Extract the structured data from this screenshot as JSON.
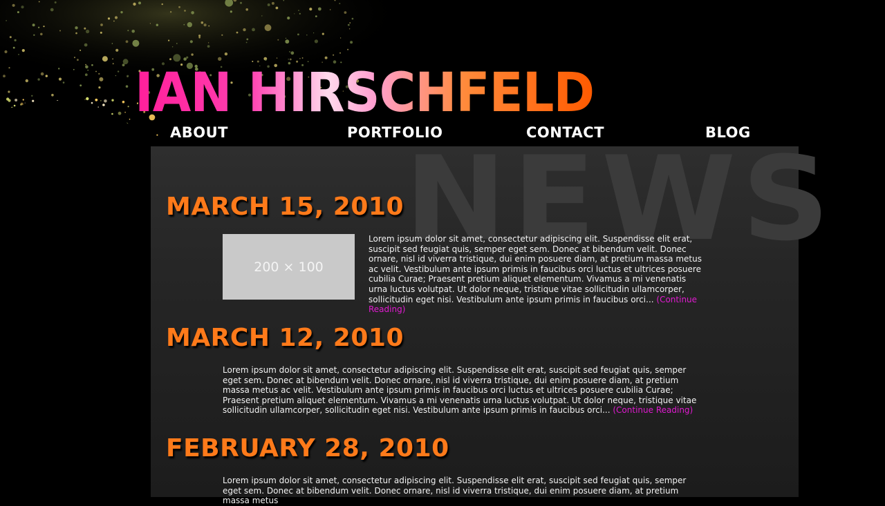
{
  "header": {
    "logo_text": "IAN HIRSCHFELD"
  },
  "nav": {
    "items": [
      {
        "label": "ABOUT"
      },
      {
        "label": "PORTFOLIO"
      },
      {
        "label": "CONTACT"
      },
      {
        "label": "BLOG"
      }
    ]
  },
  "page": {
    "watermark": "NEWS"
  },
  "posts": [
    {
      "date": "MARCH 15, 2010",
      "thumbnail_label": "200 × 100",
      "excerpt": "Lorem ipsum dolor sit amet, consectetur adipiscing elit. Suspendisse elit erat, suscipit sed feugiat quis, semper eget sem. Donec at bibendum velit. Donec ornare, nisl id viverra tristique, dui enim posuere diam, at pretium massa metus ac velit. Vestibulum ante ipsum primis in faucibus orci luctus et ultrices posuere cubilia Curae; Praesent pretium aliquet elementum. Vivamus a mi venenatis urna luctus volutpat. Ut dolor neque, tristique vitae sollicitudin ullamcorper, sollicitudin eget nisi. Vestibulum ante ipsum primis in faucibus orci...",
      "more_label": "(Continue Reading)"
    },
    {
      "date": "MARCH 12, 2010",
      "excerpt": "Lorem ipsum dolor sit amet, consectetur adipiscing elit. Suspendisse elit erat, suscipit sed feugiat quis, semper eget sem. Donec at bibendum velit. Donec ornare, nisl id viverra tristique, dui enim posuere diam, at pretium massa metus ac velit. Vestibulum ante ipsum primis in faucibus orci luctus et ultrices posuere cubilia Curae; Praesent pretium aliquet elementum. Vivamus a mi venenatis urna luctus volutpat. Ut dolor neque, tristique vitae sollicitudin ullamcorper, sollicitudin eget nisi. Vestibulum ante ipsum primis in faucibus orci...",
      "more_label": "(Continue Reading)"
    },
    {
      "date": "FEBRUARY 28, 2010",
      "excerpt": "Lorem ipsum dolor sit amet, consectetur adipiscing elit. Suspendisse elit erat, suscipit sed feugiat quis, semper eget sem. Donec at bibendum velit. Donec ornare, nisl id viverra tristique, dui enim posuere diam, at pretium massa metus"
    }
  ],
  "colors": {
    "date": "#ff7a1a",
    "link": "#e01ad0",
    "logo_pink": "#ff1f9a",
    "logo_orange": "#ff5a00"
  }
}
